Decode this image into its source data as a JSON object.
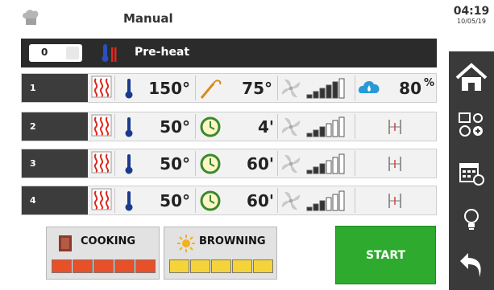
{
  "header": {
    "title": "Manual",
    "time": "04:19",
    "date": "10/05/19"
  },
  "preheat": {
    "value": "0",
    "label": "Pre-heat"
  },
  "phases": [
    {
      "num": "1",
      "temp": "150°",
      "probe": "75°",
      "humidity": "80",
      "humidity_unit": "%",
      "fan_level": 5,
      "mode": "probe"
    },
    {
      "num": "2",
      "temp": "50°",
      "time": "4'",
      "fan_level": 3,
      "mode": "timer"
    },
    {
      "num": "3",
      "temp": "50°",
      "time": "60'",
      "fan_level": 3,
      "mode": "timer"
    },
    {
      "num": "4",
      "temp": "50°",
      "time": "60'",
      "fan_level": 3,
      "mode": "timer"
    }
  ],
  "cooking": {
    "label": "COOKING",
    "level": 5,
    "color": "#e8502a"
  },
  "browning": {
    "label": "BROWNING",
    "level": 5,
    "color": "#f5d33a"
  },
  "start": {
    "label": "START"
  },
  "sidebar": {
    "items": [
      "home-icon",
      "program-settings-icon",
      "calendar-icon",
      "light-bulb-icon",
      "back-arrow-icon"
    ]
  },
  "colors": {
    "accent_red": "#d93a2b",
    "heat_red": "#e0281e",
    "thermo_blue": "#1a3a8c",
    "timer_green": "#3a8a2a",
    "humidity_blue": "#2a9ad6",
    "start_green": "#2eaa2e",
    "sidebar_dark": "#3a3a3a"
  }
}
